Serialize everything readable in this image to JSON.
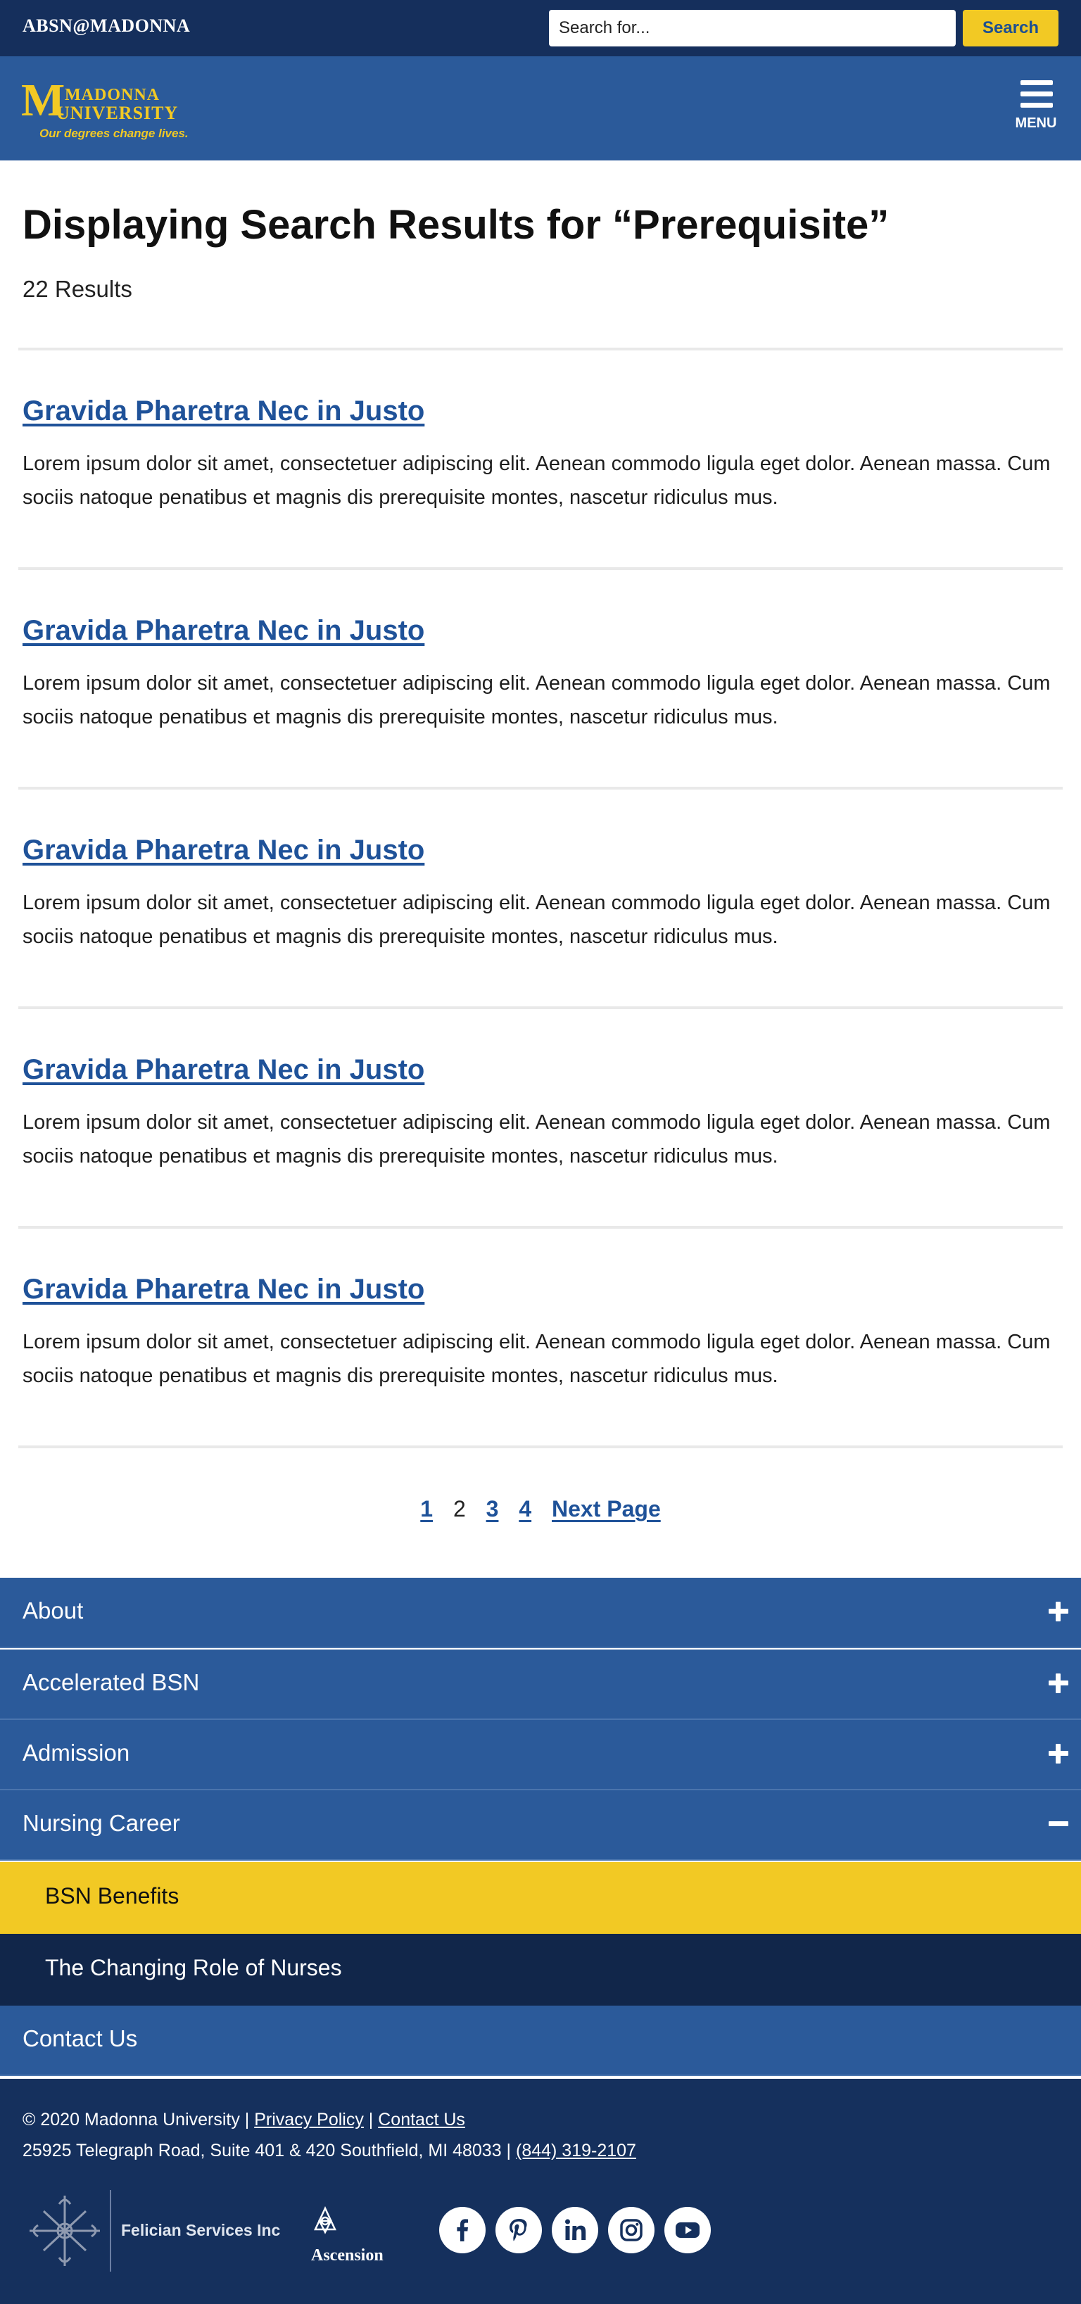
{
  "topbar": {
    "brand": "ABSN@MADONNA",
    "search_placeholder": "Search for...",
    "search_button": "Search"
  },
  "header": {
    "logo": {
      "line1": "MADONNA",
      "line2": "UNIVERSITY",
      "tagline": "Our degrees change lives."
    },
    "menu_label": "MENU"
  },
  "main": {
    "title": "Displaying Search Results for “Prerequisite”",
    "count": "22 Results",
    "results": [
      {
        "title": "Gravida Pharetra Nec in Justo",
        "desc": "Lorem ipsum dolor sit amet, consectetuer adipiscing elit. Aenean commodo ligula eget dolor. Aenean massa. Cum sociis natoque penatibus et magnis dis prerequisite montes, nascetur ridiculus mus."
      },
      {
        "title": "Gravida Pharetra Nec in Justo",
        "desc": "Lorem ipsum dolor sit amet, consectetuer adipiscing elit. Aenean commodo ligula eget dolor. Aenean massa. Cum sociis natoque penatibus et magnis dis prerequisite montes, nascetur ridiculus mus."
      },
      {
        "title": "Gravida Pharetra Nec in Justo",
        "desc": "Lorem ipsum dolor sit amet, consectetuer adipiscing elit. Aenean commodo ligula eget dolor. Aenean massa. Cum sociis natoque penatibus et magnis dis prerequisite montes, nascetur ridiculus mus."
      },
      {
        "title": "Gravida Pharetra Nec in Justo",
        "desc": "Lorem ipsum dolor sit amet, consectetuer adipiscing elit. Aenean commodo ligula eget dolor. Aenean massa. Cum sociis natoque penatibus et magnis dis prerequisite montes, nascetur ridiculus mus."
      },
      {
        "title": "Gravida Pharetra Nec in Justo",
        "desc": "Lorem ipsum dolor sit amet, consectetuer adipiscing elit. Aenean commodo ligula eget dolor. Aenean massa. Cum sociis natoque penatibus et magnis dis prerequisite montes, nascetur ridiculus mus."
      }
    ]
  },
  "pagination": {
    "pages": [
      "1",
      "2",
      "3",
      "4"
    ],
    "current": "2",
    "next": "Next Page"
  },
  "nav": {
    "items": [
      {
        "label": "About",
        "state": "collapsed"
      },
      {
        "label": "Accelerated BSN",
        "state": "collapsed"
      },
      {
        "label": "Admission",
        "state": "collapsed"
      },
      {
        "label": "Nursing Career",
        "state": "expanded"
      },
      {
        "label": "Contact Us",
        "state": "none"
      }
    ],
    "sub_items": [
      {
        "label": "BSN Benefits",
        "state": "active"
      },
      {
        "label": "The Changing Role of Nurses",
        "state": "normal"
      }
    ]
  },
  "footer": {
    "copyright": "© 2020 Madonna University | ",
    "privacy": "Privacy Policy",
    "sep": " | ",
    "contact": "Contact Us",
    "address": "25925 Telegraph Road, Suite 401 & 420 Southfield, MI 48033 | ",
    "phone": "(844) 319-2107",
    "partner1": "Felician Services Inc",
    "partner2": "Ascension",
    "socials": [
      "facebook-icon",
      "pinterest-icon",
      "linkedin-icon",
      "instagram-icon",
      "youtube-icon"
    ]
  },
  "colors": {
    "topbar": "#152f5c",
    "header": "#2b5a9a",
    "accent": "#f2c924",
    "link": "#1f5299",
    "footer": "#15305d"
  }
}
